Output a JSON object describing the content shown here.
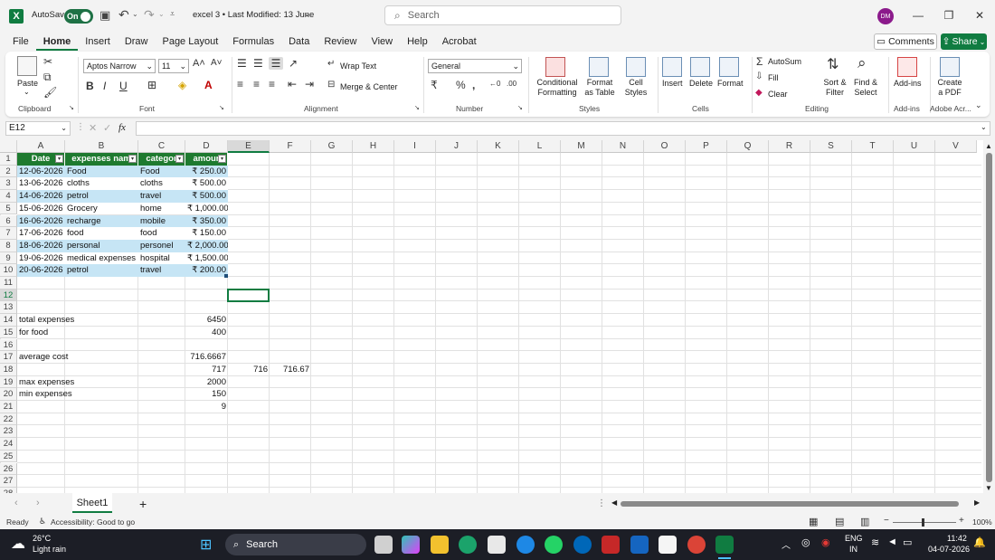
{
  "titlebar": {
    "autosave_label": "AutoSave",
    "autosave_state": "On",
    "doc_title": "excel 3 • Last Modified: 13 June",
    "search_placeholder": "Search",
    "avatar_initials": "DM"
  },
  "menu": {
    "tabs": [
      "File",
      "Home",
      "Insert",
      "Draw",
      "Page Layout",
      "Formulas",
      "Data",
      "Review",
      "View",
      "Help",
      "Acrobat"
    ],
    "active": "Home",
    "comments_label": "Comments",
    "share_label": "Share"
  },
  "ribbon": {
    "clipboard": {
      "paste": "Paste",
      "label": "Clipboard"
    },
    "font": {
      "name": "Aptos Narrow",
      "size": "11",
      "label": "Font",
      "bold": "B",
      "italic": "I",
      "underline": "U"
    },
    "alignment": {
      "wrap": "Wrap Text",
      "merge": "Merge & Center",
      "label": "Alignment"
    },
    "number": {
      "format": "General",
      "label": "Number"
    },
    "styles": {
      "conditional": "Conditional Formatting",
      "format_table": "Format as Table",
      "cell_styles": "Cell Styles",
      "label": "Styles"
    },
    "cells": {
      "insert": "Insert",
      "delete": "Delete",
      "format": "Format",
      "label": "Cells"
    },
    "editing": {
      "autosum": "AutoSum",
      "fill": "Fill",
      "clear": "Clear",
      "sort": "Sort & Filter",
      "find": "Find & Select",
      "label": "Editing"
    },
    "addins": {
      "addins": "Add-ins",
      "label": "Add-ins"
    },
    "adobe": {
      "create_pdf": "Create a PDF",
      "label": "Adobe Acr..."
    }
  },
  "formula_bar": {
    "name_box": "E12",
    "fx": "fx",
    "content": ""
  },
  "grid": {
    "columns": [
      "A",
      "B",
      "C",
      "D",
      "E",
      "F",
      "G",
      "H",
      "I",
      "J",
      "K",
      "L",
      "M",
      "N",
      "O",
      "P",
      "Q",
      "R",
      "S",
      "T",
      "U",
      "V"
    ],
    "row_numbers": [
      "1",
      "2",
      "3",
      "4",
      "5",
      "6",
      "7",
      "8",
      "9",
      "10",
      "11",
      "12",
      "13",
      "14",
      "15",
      "16",
      "17",
      "18",
      "19",
      "20",
      "21",
      "22",
      "23",
      "24",
      "25",
      "26",
      "27",
      "28"
    ],
    "table_headers": [
      "Date",
      "expenses nam",
      "categor",
      "amour"
    ],
    "table_rows": [
      [
        "12-06-2026",
        "Food",
        "Food",
        "₹ 250.00"
      ],
      [
        "13-06-2026",
        "cloths",
        "cloths",
        "₹ 500.00"
      ],
      [
        "14-06-2026",
        "petrol",
        "travel",
        "₹ 500.00"
      ],
      [
        "15-06-2026",
        "Grocery",
        "home",
        "₹ 1,000.00"
      ],
      [
        "16-06-2026",
        "recharge",
        "mobile",
        "₹ 350.00"
      ],
      [
        "17-06-2026",
        "food",
        "food",
        "₹ 150.00"
      ],
      [
        "18-06-2026",
        "personal",
        "personel",
        "₹ 2,000.00"
      ],
      [
        "19-06-2026",
        "medical expenses",
        "hospital",
        "₹ 1,500.00"
      ],
      [
        "20-06-2026",
        "petrol",
        "travel",
        "₹ 200.00"
      ]
    ],
    "summary": {
      "total_label": "total expenses",
      "total_value": "6450",
      "food_label": "for food",
      "food_value": "400",
      "avg_label": "average cost",
      "avg_value": "716.6667",
      "avg_round_d": "717",
      "avg_round_e": "716",
      "avg_round_f": "716.67",
      "max_label": "max expenses",
      "max_value": "2000",
      "min_label": "min expenses",
      "min_value": "150",
      "count_value": "9"
    },
    "colors": {
      "table_header": "#1e7a2f",
      "band_light": "#c6e5f5",
      "band_white": "#ffffff"
    }
  },
  "sheets": {
    "active": "Sheet1",
    "add": "+"
  },
  "status": {
    "ready": "Ready",
    "accessibility": "Accessibility: Good to go",
    "zoom": "100%"
  },
  "taskbar": {
    "weather_temp": "26°C",
    "weather_desc": "Light rain",
    "search": "Search",
    "lang": "ENG",
    "region": "IN",
    "time": "11:42",
    "date": "04-07-2026"
  }
}
